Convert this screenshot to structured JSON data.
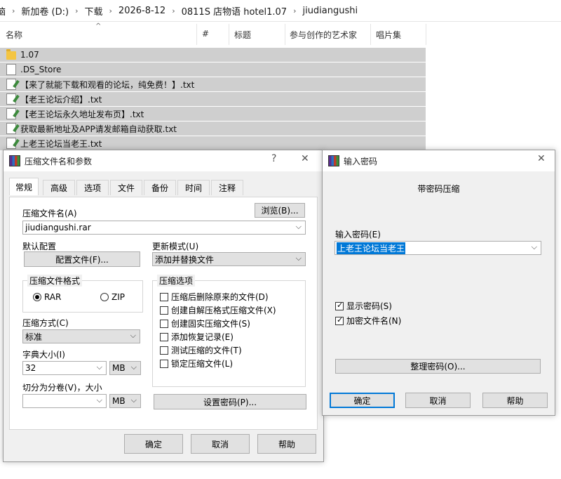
{
  "breadcrumb": [
    "脑",
    "新加卷 (D:)",
    "下载",
    "2026-8-12",
    "0811S 店物语 hotel1.07",
    "jiudiangushi"
  ],
  "columns": [
    "名称",
    "#",
    "标题",
    "参与创作的艺术家",
    "唱片集"
  ],
  "files": [
    {
      "name": "1.07",
      "icon": "folder-icon"
    },
    {
      "name": ".DS_Store",
      "icon": "document-icon"
    },
    {
      "name": "【来了就能下载和观看的论坛，纯免费！】.txt",
      "icon": "text-file-icon"
    },
    {
      "name": "【老王论坛介绍】.txt",
      "icon": "text-file-icon"
    },
    {
      "name": "【老王论坛永久地址发布页】.txt",
      "icon": "text-file-icon"
    },
    {
      "name": "获取最新地址及APP请发邮箱自动获取.txt",
      "icon": "text-file-icon"
    },
    {
      "name": "上老王论坛当老王.txt",
      "icon": "text-file-icon"
    }
  ],
  "archive_dialog": {
    "title": "压缩文件名和参数",
    "help_glyph": "?",
    "close_glyph": "✕",
    "tabs": [
      "常规",
      "高级",
      "选项",
      "文件",
      "备份",
      "时间",
      "注释"
    ],
    "active_tab": "常规",
    "archive_name_label": "压缩文件名(A)",
    "browse_button": "浏览(B)...",
    "archive_name_value": "jiudiangushi.rar",
    "default_profile_label": "默认配置",
    "profiles_button": "配置文件(F)...",
    "update_mode_label": "更新模式(U)",
    "update_mode_value": "添加并替换文件",
    "format_group_title": "压缩文件格式",
    "format_rar": "RAR",
    "format_zip": "ZIP",
    "format_selected": "RAR",
    "method_label": "压缩方式(C)",
    "method_value": "标准",
    "dict_label": "字典大小(I)",
    "dict_value": "32",
    "dict_unit": "MB",
    "split_label": "切分为分卷(V)，大小",
    "split_value": "",
    "split_unit": "MB",
    "options_group_title": "压缩选项",
    "options": [
      {
        "label": "压缩后删除原来的文件(D)",
        "checked": false
      },
      {
        "label": "创建自解压格式压缩文件(X)",
        "checked": false
      },
      {
        "label": "创建固实压缩文件(S)",
        "checked": false
      },
      {
        "label": "添加恢复记录(E)",
        "checked": false
      },
      {
        "label": "测试压缩的文件(T)",
        "checked": false
      },
      {
        "label": "锁定压缩文件(L)",
        "checked": false
      }
    ],
    "set_password_button": "设置密码(P)...",
    "ok_button": "确定",
    "cancel_button": "取消",
    "help_button": "帮助"
  },
  "password_dialog": {
    "title": "输入密码",
    "close_glyph": "✕",
    "heading": "带密码压缩",
    "password_label": "输入密码(E)",
    "password_value": "上老王论坛当老王",
    "show_password_label": "显示密码(S)",
    "show_password_checked": true,
    "encrypt_names_label": "加密文件名(N)",
    "encrypt_names_checked": true,
    "organize_button": "整理密码(O)...",
    "ok_button": "确定",
    "cancel_button": "取消",
    "help_button": "帮助"
  },
  "colors": {
    "selection": "#0078d7",
    "file_row_bg": "#cfcfcf",
    "dialog_bg": "#f0f0f0"
  }
}
